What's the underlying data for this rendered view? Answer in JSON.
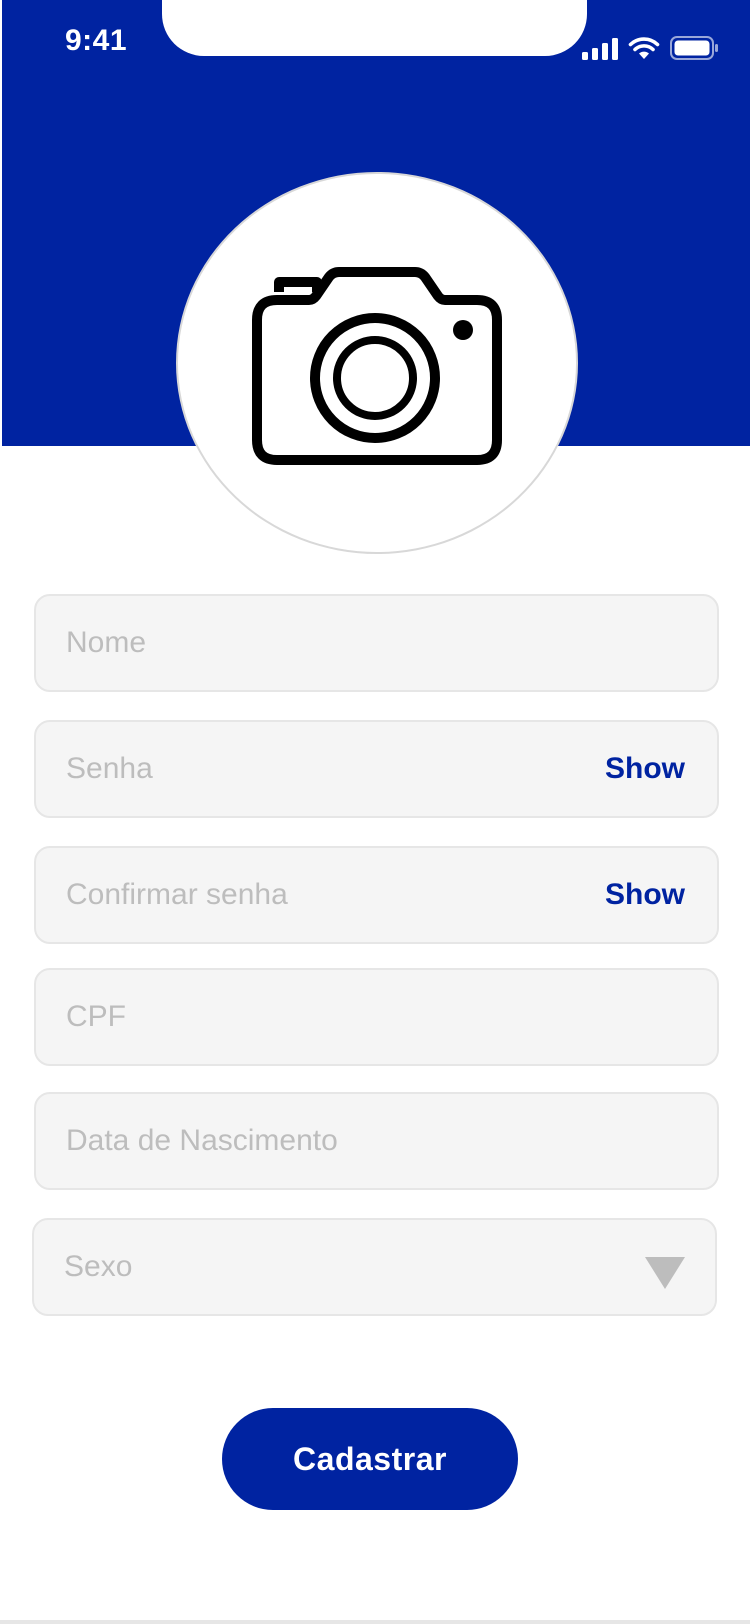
{
  "status_bar": {
    "time": "9:41",
    "icons": [
      "signal-icon",
      "wifi-icon",
      "battery-icon"
    ]
  },
  "colors": {
    "brand": "#0023a1",
    "field_bg": "#f5f5f5",
    "placeholder": "#bdbdbd"
  },
  "avatar": {
    "icon": "camera-icon"
  },
  "form": {
    "name_placeholder": "Nome",
    "password_placeholder": "Senha",
    "password_show_label": "Show",
    "confirm_password_placeholder": "Confirmar senha",
    "confirm_password_show_label": "Show",
    "cpf_placeholder": "CPF",
    "birthdate_placeholder": "Data de Nascimento",
    "gender_placeholder": "Sexo",
    "submit_label": "Cadastrar"
  }
}
